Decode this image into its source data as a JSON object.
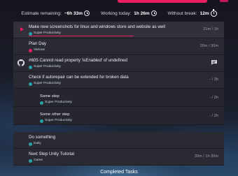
{
  "stats": {
    "estimate_label": "Estimate remaining:",
    "estimate_value": "~6h 33m",
    "working_label": "Working today:",
    "working_value": "1h 26m",
    "break_label": "Without break:",
    "break_value": "12m"
  },
  "tasks": [
    {
      "title": "Make new screenshots for linux and windows store and website as well",
      "tag": "Super Productivity",
      "tag_color": "#29a1aa",
      "time": "21m / 1h",
      "current": true,
      "progress": 0.35
    },
    {
      "title": "Plan Day",
      "tag": "Various",
      "tag_color": "#e91e63",
      "time": "25m / 30m"
    },
    {
      "title": "#605 Cannot read property 'isEnabled' of undefined",
      "tag": "Super Productivity",
      "tag_color": "#29a1aa",
      "time": "",
      "icon": "github-icon"
    },
    {
      "title": "Check if autorepair can be extended for broken data",
      "tag": "Super Productivity",
      "tag_color": "#29a1aa",
      "time": "- / 3h"
    },
    {
      "title": "Some step",
      "tag": "Super Productivity",
      "tag_color": "#29a1aa",
      "time": "- / 2h",
      "sub": true
    },
    {
      "title": "Some other step",
      "tag": "Super Productivity",
      "tag_color": "#29a1aa",
      "time": "- / 2h",
      "sub": true
    }
  ],
  "tasks2": [
    {
      "title": "Do something",
      "tag": "Daily",
      "tag_color": "#29a1aa",
      "time": ""
    },
    {
      "title": "Next Step Unity Tutorial",
      "tag": "Game",
      "tag_color": "#29a1aa",
      "time": "30m / 1h 30m"
    }
  ],
  "completed_label": "Completed Tasks",
  "colors": {
    "accent": "#e91e63",
    "tag_teal": "#29a1aa"
  }
}
